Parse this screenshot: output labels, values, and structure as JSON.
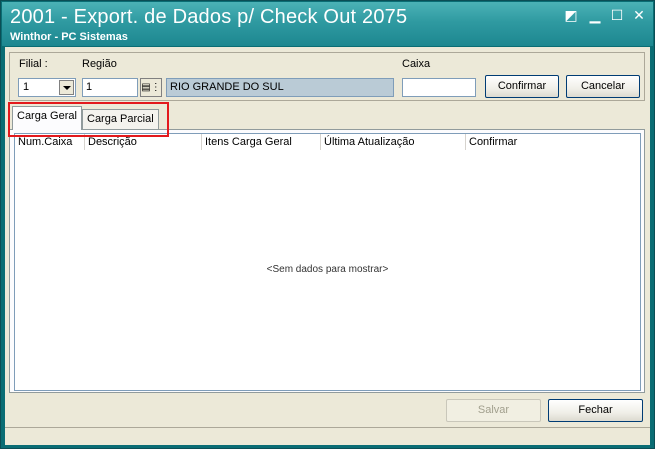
{
  "window": {
    "title": "2001 - Export. de Dados p/ Check Out 2075",
    "subtitle": "Winthor - PC Sistemas"
  },
  "filters": {
    "filial_label": "Filial :",
    "filial_value": "1",
    "regiao_label": "Região",
    "regiao_value": "1",
    "regiao_name": "RIO GRANDE DO SUL",
    "caixa_label": "Caixa",
    "caixa_value": ""
  },
  "buttons": {
    "confirmar": "Confirmar",
    "cancelar": "Cancelar",
    "salvar": "Salvar",
    "fechar": "Fechar"
  },
  "tabs": [
    {
      "label": "Carga Geral",
      "active": true
    },
    {
      "label": "Carga Parcial",
      "active": false
    }
  ],
  "grid": {
    "columns": [
      "Num.Caixa",
      "Descrição",
      "Itens Carga Geral",
      "Última Atualização",
      "Confirmar"
    ],
    "empty_text": "<Sem dados para mostrar>"
  },
  "colors": {
    "titlebar": "#2f9aa1",
    "highlight": "#e3191d",
    "readonly_field": "#bacbd6"
  }
}
